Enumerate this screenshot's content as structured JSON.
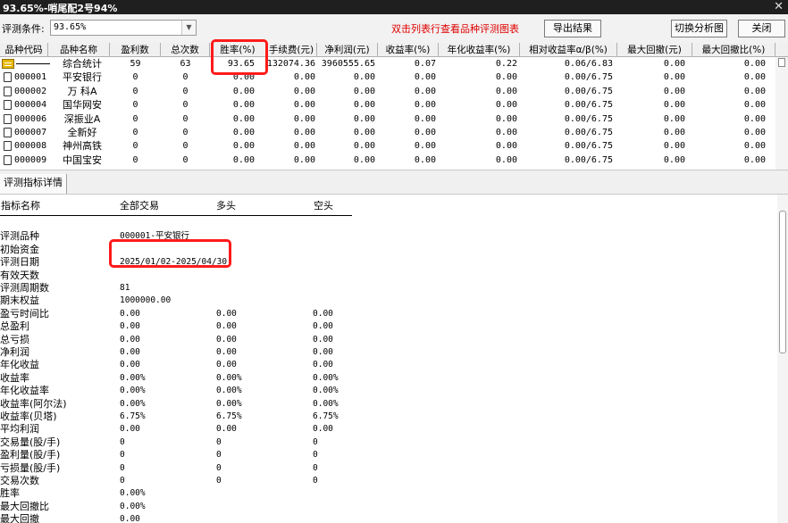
{
  "window": {
    "title": "93.65%-哨尾配2号94%",
    "close_symbol": "✕"
  },
  "toolbar": {
    "condition_label": "评测条件:",
    "condition_value": "93.65%",
    "hint": "双击列表行查看品种评测图表",
    "export_label": "导出结果",
    "switch_label": "切换分析图",
    "close_label": "关闭"
  },
  "table": {
    "headers": [
      "品种代码",
      "品种名称",
      "盈利数",
      "总次数",
      "胜率(%)",
      "手续费(元)",
      "净利润(元)",
      "收益率(%)",
      "年化收益率(%)",
      "相对收益率α/β(%)",
      "最大回撤(元)",
      "最大回撤比(%)"
    ],
    "summary": {
      "code": "",
      "name": "综合统计",
      "win": "59",
      "total": "63",
      "winrate": "93.65",
      "fee": "132074.36",
      "net": "3960555.65",
      "ret": "0.07",
      "annual": "0.22",
      "relative": "0.06/6.83",
      "maxdd": "0.00",
      "maxddr": "0.00"
    },
    "rows": [
      {
        "code": "000001",
        "name": "平安银行",
        "win": "0",
        "total": "0",
        "winrate": "0.00",
        "fee": "0.00",
        "net": "0.00",
        "ret": "0.00",
        "annual": "0.00",
        "relative": "0.00/6.75",
        "maxdd": "0.00",
        "maxddr": "0.00"
      },
      {
        "code": "000002",
        "name": "万 科A",
        "win": "0",
        "total": "0",
        "winrate": "0.00",
        "fee": "0.00",
        "net": "0.00",
        "ret": "0.00",
        "annual": "0.00",
        "relative": "0.00/6.75",
        "maxdd": "0.00",
        "maxddr": "0.00"
      },
      {
        "code": "000004",
        "name": "国华网安",
        "win": "0",
        "total": "0",
        "winrate": "0.00",
        "fee": "0.00",
        "net": "0.00",
        "ret": "0.00",
        "annual": "0.00",
        "relative": "0.00/6.75",
        "maxdd": "0.00",
        "maxddr": "0.00"
      },
      {
        "code": "000006",
        "name": "深振业A",
        "win": "0",
        "total": "0",
        "winrate": "0.00",
        "fee": "0.00",
        "net": "0.00",
        "ret": "0.00",
        "annual": "0.00",
        "relative": "0.00/6.75",
        "maxdd": "0.00",
        "maxddr": "0.00"
      },
      {
        "code": "000007",
        "name": "全新好",
        "win": "0",
        "total": "0",
        "winrate": "0.00",
        "fee": "0.00",
        "net": "0.00",
        "ret": "0.00",
        "annual": "0.00",
        "relative": "0.00/6.75",
        "maxdd": "0.00",
        "maxddr": "0.00"
      },
      {
        "code": "000008",
        "name": "神州高铁",
        "win": "0",
        "total": "0",
        "winrate": "0.00",
        "fee": "0.00",
        "net": "0.00",
        "ret": "0.00",
        "annual": "0.00",
        "relative": "0.00/6.75",
        "maxdd": "0.00",
        "maxddr": "0.00"
      },
      {
        "code": "000009",
        "name": "中国宝安",
        "win": "0",
        "total": "0",
        "winrate": "0.00",
        "fee": "0.00",
        "net": "0.00",
        "ret": "0.00",
        "annual": "0.00",
        "relative": "0.00/6.75",
        "maxdd": "0.00",
        "maxddr": "0.00"
      }
    ]
  },
  "detail_tab": "评测指标详情",
  "detail": {
    "headers": [
      "指标名称",
      "全部交易",
      "多头",
      "空头"
    ],
    "rows": [
      {
        "label": "",
        "all": "",
        "long": "",
        "short": ""
      },
      {
        "label": "评测品种",
        "all": "000001-平安银行",
        "long": "",
        "short": ""
      },
      {
        "label": "初始资金",
        "all": "",
        "long": "",
        "short": ""
      },
      {
        "label": "评测日期",
        "all": "2025/01/02-2025/04/30",
        "long": "",
        "short": ""
      },
      {
        "label": "有效天数",
        "all": "",
        "long": "",
        "short": ""
      },
      {
        "label": "评测周期数",
        "all": "81",
        "long": "",
        "short": ""
      },
      {
        "label": "期末权益",
        "all": "1000000.00",
        "long": "",
        "short": ""
      },
      {
        "label": "盈亏时间比",
        "all": "0.00",
        "long": "0.00",
        "short": "0.00"
      },
      {
        "label": "总盈利",
        "all": "0.00",
        "long": "0.00",
        "short": "0.00"
      },
      {
        "label": "总亏损",
        "all": "0.00",
        "long": "0.00",
        "short": "0.00"
      },
      {
        "label": "净利润",
        "all": "0.00",
        "long": "0.00",
        "short": "0.00"
      },
      {
        "label": "年化收益",
        "all": "0.00",
        "long": "0.00",
        "short": "0.00"
      },
      {
        "label": "收益率",
        "all": "0.00%",
        "long": "0.00%",
        "short": "0.00%"
      },
      {
        "label": "年化收益率",
        "all": "0.00%",
        "long": "0.00%",
        "short": "0.00%"
      },
      {
        "label": "收益率(阿尔法)",
        "all": "0.00%",
        "long": "0.00%",
        "short": "0.00%"
      },
      {
        "label": "收益率(贝塔)",
        "all": "6.75%",
        "long": "6.75%",
        "short": "6.75%"
      },
      {
        "label": "平均利润",
        "all": "0.00",
        "long": "0.00",
        "short": "0.00"
      },
      {
        "label": "交易量(股/手)",
        "all": "0",
        "long": "0",
        "short": "0"
      },
      {
        "label": "盈利量(股/手)",
        "all": "0",
        "long": "0",
        "short": "0"
      },
      {
        "label": "亏损量(股/手)",
        "all": "0",
        "long": "0",
        "short": "0"
      },
      {
        "label": "交易次数",
        "all": "0",
        "long": "0",
        "short": "0"
      },
      {
        "label": "胜率",
        "all": "0.00%",
        "long": "",
        "short": ""
      },
      {
        "label": "最大回撤比",
        "all": "0.00%",
        "long": "",
        "short": ""
      },
      {
        "label": "最大回撤",
        "all": "0.00",
        "long": "",
        "short": ""
      }
    ]
  },
  "colors": {
    "hint": "#e00000",
    "highlight": "#ff1a1a",
    "titlebar": "#1f1f1f"
  },
  "icons": {
    "summary": "folder-icon",
    "row": "document-icon",
    "dropdown": "chevron-down-icon"
  }
}
